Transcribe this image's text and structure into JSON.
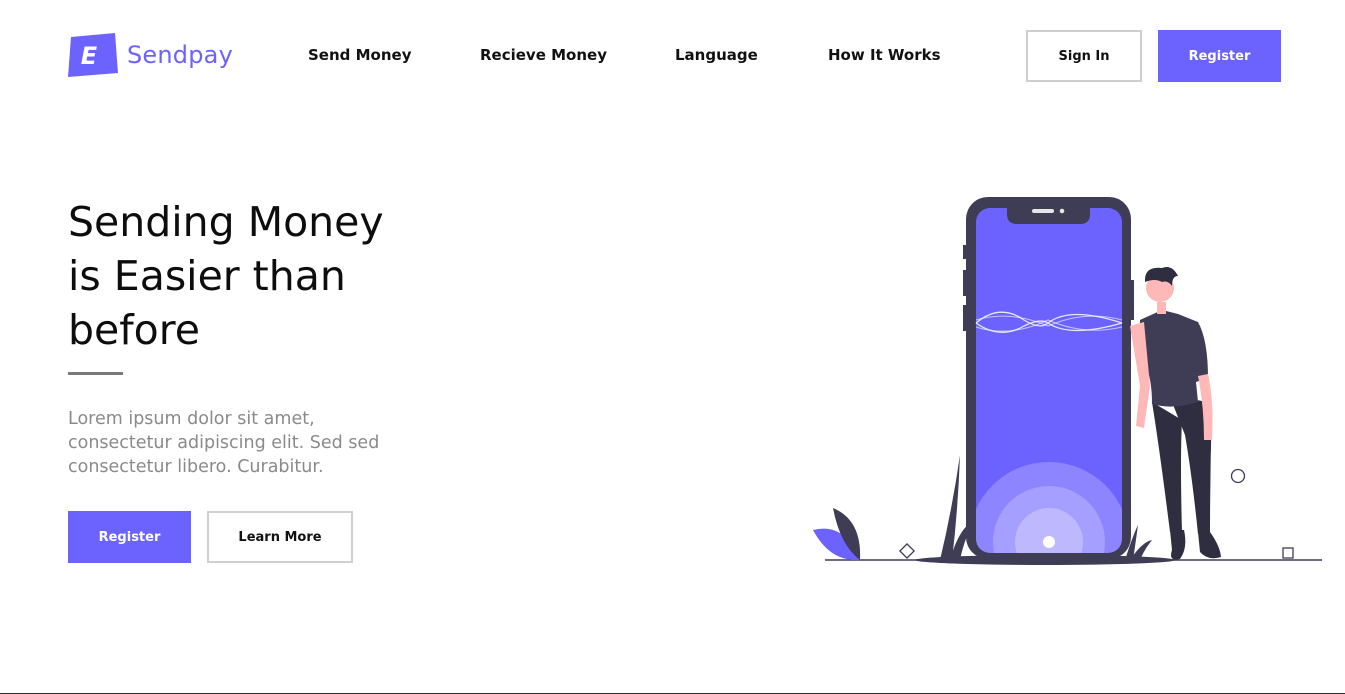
{
  "brand": {
    "name": "Sendpay",
    "logo_letter": "E",
    "accent_color": "#6c63ff"
  },
  "nav": {
    "items": [
      {
        "label": "Send Money"
      },
      {
        "label": "Recieve Money"
      },
      {
        "label": "Language"
      },
      {
        "label": "How It Works"
      }
    ]
  },
  "header_actions": {
    "sign_in_label": "Sign In",
    "register_label": "Register"
  },
  "hero": {
    "title_lines": [
      "Sending Money",
      "is Easier than",
      "before"
    ],
    "description_lines": [
      "Lorem ipsum dolor sit amet,",
      "consectetur adipiscing elit. Sed sed",
      "consectetur libero. Curabitur."
    ],
    "primary_label": "Register",
    "secondary_label": "Learn More"
  },
  "illustration": {
    "name": "person-with-phone-illustration",
    "colors": {
      "primary": "#6c63ff",
      "dark": "#3f3d56",
      "skin": "#ffb8b8",
      "hair": "#2f2e41"
    }
  }
}
